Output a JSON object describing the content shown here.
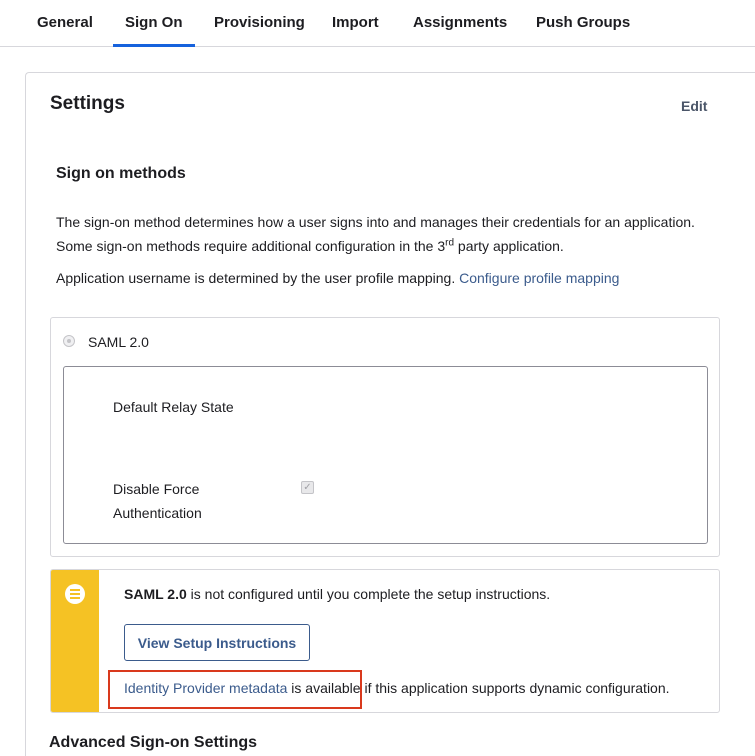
{
  "tabs": [
    {
      "label": "General"
    },
    {
      "label": "Sign On"
    },
    {
      "label": "Provisioning"
    },
    {
      "label": "Import"
    },
    {
      "label": "Assignments"
    },
    {
      "label": "Push Groups"
    }
  ],
  "active_tab": "Sign On",
  "settings": {
    "title": "Settings",
    "edit_label": "Edit",
    "sign_on_methods": {
      "title": "Sign on methods",
      "description_part1": "The sign-on method determines how a user signs into and manages their credentials for an application. Some sign-on methods require additional configuration in the 3",
      "description_sup": "rd",
      "description_part2": " party application.",
      "profile_text": "Application username is determined by the user profile mapping. ",
      "profile_link": "Configure profile mapping"
    },
    "saml": {
      "label": "SAML 2.0",
      "default_relay_state_label": "Default Relay State",
      "disable_force_auth_label_line1": "Disable Force",
      "disable_force_auth_label_line2": "Authentication",
      "disable_force_auth_checked": true
    },
    "callout": {
      "icon": "list-icon",
      "strong_text": "SAML 2.0",
      "text": " is not configured until you complete the setup instructions.",
      "button_label": "View Setup Instructions",
      "metadata_link": "Identity Provider metadata",
      "metadata_text": " is available if this application supports dynamic configuration.",
      "color": "#f5c224"
    },
    "advanced_title": "Advanced Sign-on Settings"
  }
}
